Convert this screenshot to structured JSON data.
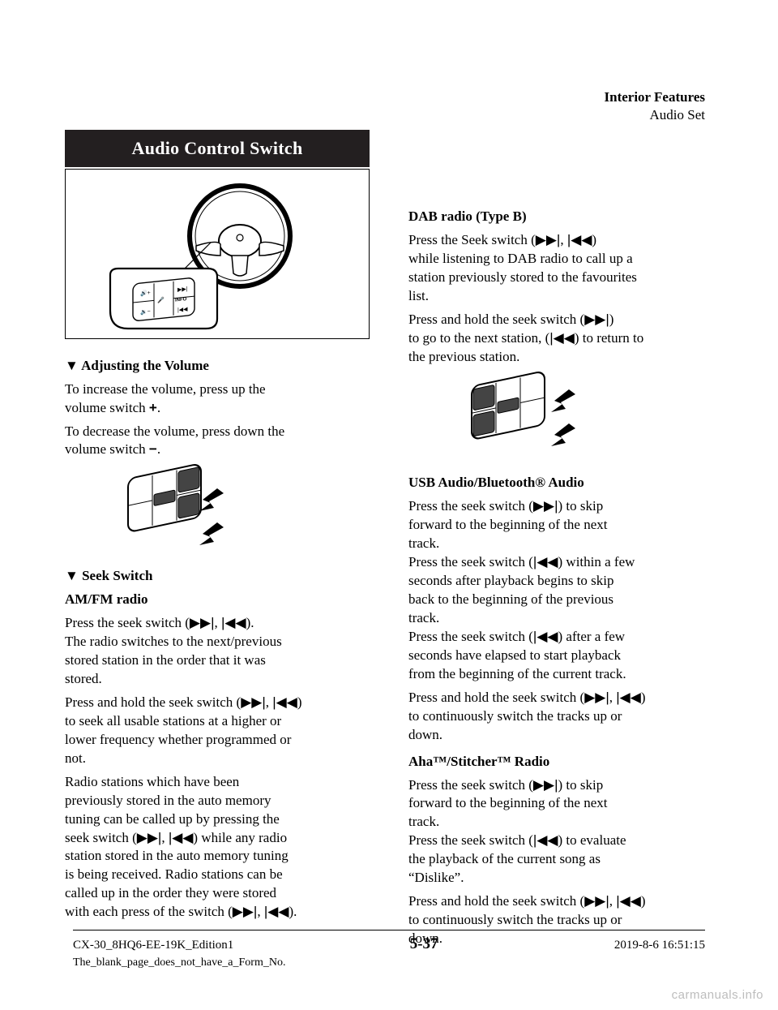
{
  "running_head": {
    "line1": "Interior Features",
    "line2": "Audio Set"
  },
  "section_title": "Audio Control Switch",
  "left": {
    "vol_heading_prefix": "Adjusting the Volume",
    "vol_line1": "To increase the volume, press up the",
    "vol_line2_prefix": "volume switch ",
    "vol_plus": "+",
    "vol_line2_suffix": ".",
    "vol_line3": "To decrease the volume, press down the",
    "vol_line4_prefix": "volume switch ",
    "vol_minus": "−",
    "vol_line4_suffix": ".",
    "seek_heading": "Seek Switch",
    "am_fm_heading": "AM/FM radio",
    "am_fm_line1_prefix": "Press the seek switch (",
    "ff": "▶▶|",
    "rw": "|◀◀",
    "am_fm_line1_mid": ", ",
    "am_fm_line1_suffix": ").",
    "am_fm_line2": "The radio switches to the next/previous",
    "am_fm_line3": "stored station in the order that it was",
    "am_fm_line4": "stored.",
    "am_fm_hold_line1_prefix": "Press and hold the seek switch (",
    "am_fm_hold_line1_suffix": ")",
    "am_fm_hold_line2": "to seek all usable stations at a higher or",
    "am_fm_hold_line3": "lower frequency whether programmed or",
    "am_fm_hold_line4": "not.",
    "am_fm_hold2_line1": "Radio stations which have been",
    "am_fm_hold2_line2": "previously stored in the auto memory",
    "am_fm_hold2_line3": "tuning can be called up by pressing the",
    "am_fm_hold2_line4": "seek switch (",
    "am_fm_hold2_line4_suffix": ") while any radio",
    "am_fm_hold2_line5": "station stored in the auto memory tuning",
    "am_fm_hold2_line6": "is being received. Radio stations can be",
    "am_fm_hold2_line7": "called up in the order they were stored",
    "am_fm_hold2_line8_prefix": "with each press of the switch (",
    "am_fm_hold2_line8_suffix": ")."
  },
  "right": {
    "dab_heading": "DAB radio (Type B)",
    "dab_line1_prefix": "Press the Seek switch (",
    "dab_line1_suffix": ")",
    "dab_line2": "while listening to DAB radio to call up a",
    "dab_line3": "station previously stored to the favourites",
    "dab_line4": "list.",
    "dab_hold_line1_prefix": "Press and hold the seek switch (",
    "dab_hold_line1_suffix": ")",
    "dab_hold_line2": "to go to the next station, (",
    "dab_hold_line2_suffix": ") to return to",
    "dab_hold_line3": "the previous station.",
    "usb_heading": "USB Audio/Bluetooth® Audio",
    "usb_line1_prefix": "Press the seek switch (",
    "usb_line1_suffix": ") to skip",
    "usb_line2": "forward to the beginning of the next",
    "usb_line3": "track.",
    "usb_line4_prefix": "Press the seek switch (",
    "usb_line4_suffix": ") within a few",
    "usb_line5": "seconds after playback begins to skip",
    "usb_line6": "back to the beginning of the previous",
    "usb_line7": "track.",
    "usb_line8_prefix": "Press the seek switch (",
    "usb_line8_suffix": ") after a few",
    "usb_line9": "seconds have elapsed to start playback",
    "usb_line10": "from the beginning of the current track.",
    "usb_hold_line1_prefix": "Press and hold the seek switch (",
    "usb_hold_line1_suffix": ")",
    "usb_hold_line2": "to continuously switch the tracks up or",
    "usb_hold_line3": "down.",
    "aha_heading": "Aha™/Stitcher™ Radio",
    "aha_line1_prefix": "Press the seek switch (",
    "aha_line1_suffix": ") to skip",
    "aha_line2": "forward to the beginning of the next",
    "aha_line3": "track.",
    "aha_line4_prefix": "Press the seek switch (",
    "aha_line4_suffix": ") to evaluate",
    "aha_line5": "the playback of the current song as",
    "aha_line6": "“Dislike”.",
    "aha_hold_line1_prefix": "Press and hold the seek switch (",
    "aha_hold_line1_suffix": ")",
    "aha_hold_line2": "to continuously switch the tracks up or",
    "aha_hold_line3": "down."
  },
  "footer": {
    "page": "5-37",
    "edition": "CX-30_8HQ6-EE-19K_Edition1",
    "date": "2019-8-6 16:51:15",
    "doc": "The_blank_page_does_not_have_a_Form_No."
  },
  "watermark": "carmanuals.info"
}
